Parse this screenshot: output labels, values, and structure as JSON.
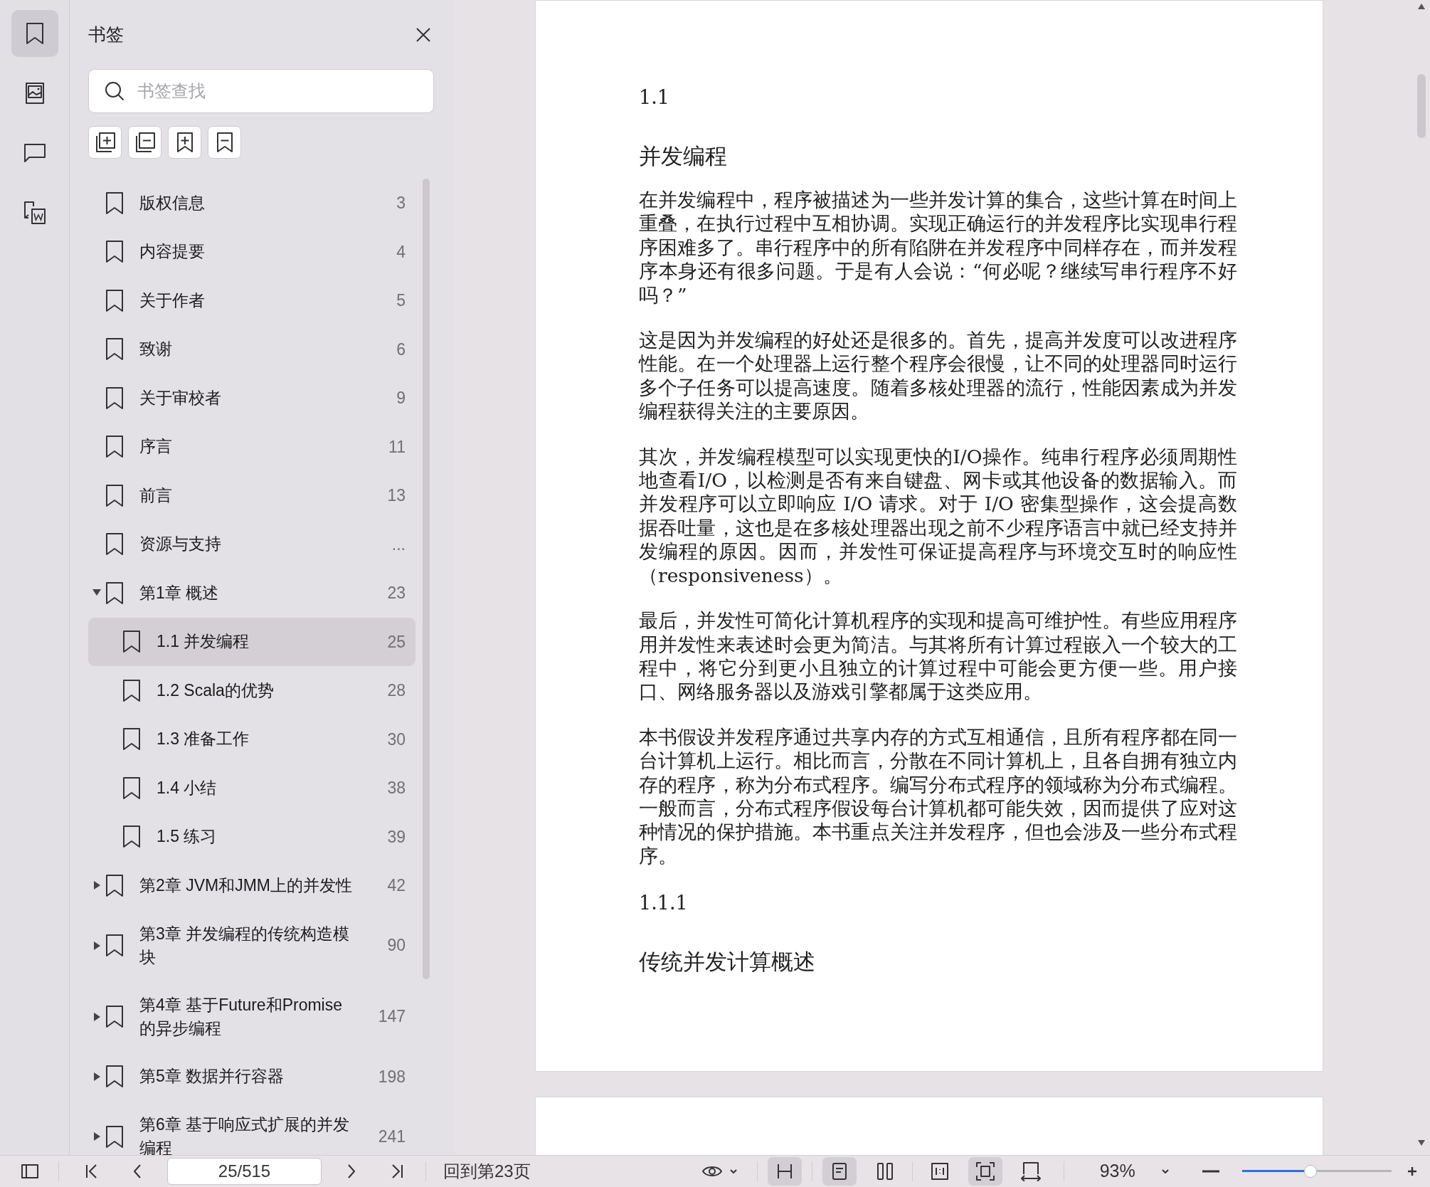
{
  "rail": [
    {
      "kind": "bookmark",
      "selected": true
    },
    {
      "kind": "image",
      "selected": false
    },
    {
      "kind": "comment",
      "selected": false
    },
    {
      "kind": "convert",
      "selected": false
    }
  ],
  "sidebar": {
    "title": "书签",
    "search": {
      "placeholder": "书签查找"
    },
    "tools": [
      {
        "kind": "expand-all"
      },
      {
        "kind": "collapse-all"
      },
      {
        "kind": "add"
      },
      {
        "kind": "remove"
      }
    ],
    "bookmarks": [
      {
        "title": "版权信息",
        "page": "3",
        "selected": false
      },
      {
        "title": "内容提要",
        "page": "4",
        "selected": false
      },
      {
        "title": "关于作者",
        "page": "5",
        "selected": false
      },
      {
        "title": "致谢",
        "page": "6",
        "selected": false
      },
      {
        "title": "关于审校者",
        "page": "9",
        "selected": false
      },
      {
        "title": "序言",
        "page": "11",
        "selected": false
      },
      {
        "title": "前言",
        "page": "13",
        "selected": false
      },
      {
        "title": "资源与支持",
        "page": "...",
        "selected": false
      },
      {
        "title": "第1章 概述",
        "page": "23",
        "selected": false,
        "expanded": true,
        "children": [
          {
            "title": "1.1 并发编程",
            "page": "25",
            "selected": true
          },
          {
            "title": "1.2 Scala的优势",
            "page": "28",
            "selected": false
          },
          {
            "title": "1.3 准备工作",
            "page": "30",
            "selected": false
          },
          {
            "title": "1.4 小结",
            "page": "38",
            "selected": false
          },
          {
            "title": "1.5 练习",
            "page": "39",
            "selected": false
          }
        ]
      },
      {
        "title": "第2章 JVM和JMM上的并发性",
        "page": "42",
        "selected": false,
        "expanded": false
      },
      {
        "title": "第3章 并发编程的传统构造模块",
        "page": "90",
        "selected": false,
        "expanded": false
      },
      {
        "title": "第4章 基于Future和Promise的异步编程",
        "page": "147",
        "selected": false,
        "expanded": false
      },
      {
        "title": "第5章 数据并行容器",
        "page": "198",
        "selected": false,
        "expanded": false
      },
      {
        "title": "第6章 基于响应式扩展的并发编程",
        "page": "241",
        "selected": false,
        "expanded": false
      }
    ]
  },
  "document": {
    "blocks": [
      {
        "kind": "section-number",
        "text": "1.1"
      },
      {
        "kind": "heading",
        "text": "并发编程"
      },
      {
        "kind": "paragraph",
        "text": "在并发编程中，程序被描述为一些并发计算的集合，这些计算在时间上重叠，在执行过程中互相协调。实现正确运行的并发程序比实现串行程序困难多了。串行程序中的所有陷阱在并发程序中同样存在，而并发程序本身还有很多问题。于是有人会说：“何必呢？继续写串行程序不好吗？”"
      },
      {
        "kind": "paragraph",
        "text": "这是因为并发编程的好处还是很多的。首先，提高并发度可以改进程序性能。在一个处理器上运行整个程序会很慢，让不同的处理器同时运行多个子任务可以提高速度。随着多核处理器的流行，性能因素成为并发编程获得关注的主要原因。"
      },
      {
        "kind": "paragraph",
        "text": "其次，并发编程模型可以实现更快的I/O操作。纯串行程序必须周期性地查看I/O，以检测是否有来自键盘、网卡或其他设备的数据输入。而并发程序可以立即响应 I/O 请求。对于 I/O 密集型操作，这会提高数据吞吐量，这也是在多核处理器出现之前不少程序语言中就已经支持并发编程的原因。因而，并发性可保证提高程序与环境交互时的响应性（responsiveness）。"
      },
      {
        "kind": "paragraph",
        "text": "最后，并发性可简化计算机程序的实现和提高可维护性。有些应用程序用并发性来表述时会更为简洁。与其将所有计算过程嵌入一个较大的工程中，将它分到更小且独立的计算过程中可能会更方便一些。用户接口、网络服务器以及游戏引擎都属于这类应用。"
      },
      {
        "kind": "paragraph",
        "text": "本书假设并发程序通过共享内存的方式互相通信，且所有程序都在同一台计算机上运行。相比而言，分散在不同计算机上，且各自拥有独立内存的程序，称为分布式程序。编写分布式程序的领域称为分布式编程。一般而言，分布式程序假设每台计算机都可能失效，因而提供了应对这种情况的保护措施。本书重点关注并发程序，但也会涉及一些分布式程序。"
      },
      {
        "kind": "section-number",
        "text": "1.1.1"
      },
      {
        "kind": "heading",
        "text": "传统并发计算概述"
      }
    ]
  },
  "toolbar": {
    "page_field": "25/515",
    "back_link": "回到第23页",
    "view_buttons": [
      {
        "kind": "continuous",
        "selected": true
      },
      {
        "kind": "single",
        "selected": true
      },
      {
        "kind": "two-page",
        "selected": false
      },
      {
        "kind": "actual-size",
        "selected": false
      },
      {
        "kind": "fit-page",
        "selected": true
      },
      {
        "kind": "fit-width",
        "selected": false
      }
    ],
    "zoom": {
      "value": "93%",
      "level": 0.46
    }
  }
}
